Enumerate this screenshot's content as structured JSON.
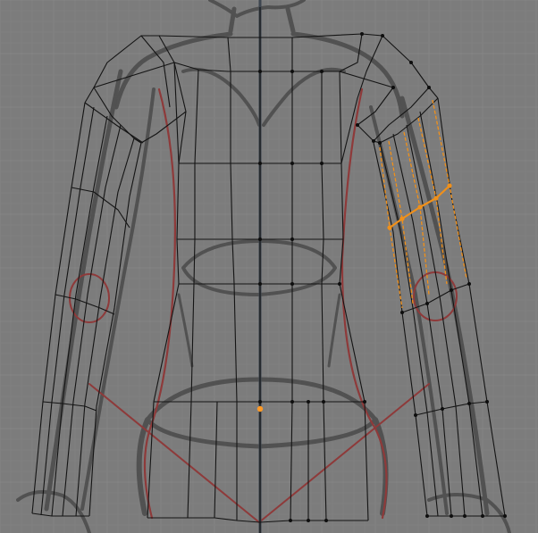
{
  "viewport": {
    "editor": "3d-viewport",
    "mode": "edit-mode",
    "selection": "edge-loop-upper-arm-right"
  },
  "colors": {
    "background": "#7c7c7c",
    "grid_major": "#858585",
    "grid_minor": "#808080",
    "sketch": "#4a4a4a",
    "sketch_soft": "#5e5e5e",
    "guide_red": "#8e3a3a",
    "wire": "#141414",
    "vertex": "#0e0e0e",
    "selected": "#f0901a",
    "origin": "#ff9a26",
    "axis": "#3e4650"
  }
}
